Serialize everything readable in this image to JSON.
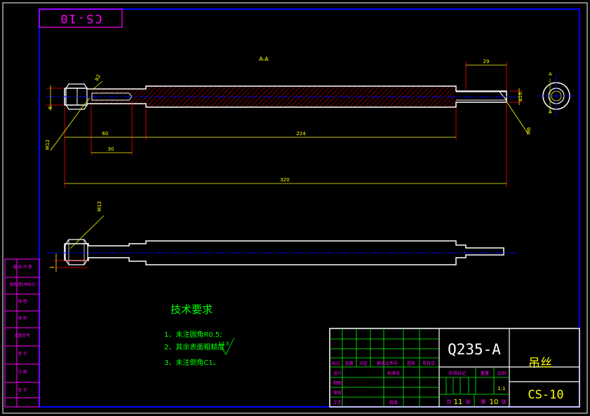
{
  "drawing_number_stamp": "CS-10",
  "section_label": "A-A",
  "section_marker": "A",
  "dimensions": {
    "d29": "29",
    "d16": "ø16",
    "d60": "60",
    "d30": "30",
    "d224": "224",
    "d320": "320",
    "r2": "R2",
    "m12_top": "M12",
    "m12_bottom": "M12",
    "m6": "M6",
    "d6": "6",
    "d1": "1"
  },
  "tech_requirements": {
    "title": "技术要求",
    "items": [
      "1、未注圆角R0.5;",
      "2、其余表面粗糙度",
      "3、未注倒角C1。"
    ],
    "roughness": "12.5"
  },
  "side_column": [
    "借 用 件 登",
    "描图(图)样标记",
    "描 图",
    "描 校",
    "底图总号",
    "签 字",
    "日 期",
    "签 字"
  ],
  "title_block": {
    "material": "Q235-A",
    "part_name": "吊丝",
    "drawing_code": "CS-10",
    "scale": "1:1",
    "revision_headers": [
      "标记",
      "处数",
      "分区",
      "更改文件号",
      "签名",
      "年月日"
    ],
    "roles": [
      "设计",
      "制图",
      "审核",
      "工艺"
    ],
    "std_label": "标准化",
    "approve_label": "批准",
    "stage_label": "阶段标记",
    "weight_label": "重量",
    "scale_label": "比例",
    "total_sheets": "11",
    "sheet_no": "10",
    "total_prefix": "共",
    "sheet_prefix": "第",
    "sheet_unit": "张"
  },
  "colors": {
    "frame": "#0000ff",
    "outline": "#ffffff",
    "dimension": "#ffff00",
    "hatch": "#ff0000",
    "grid": "#00ff00",
    "magenta": "#ff00ff",
    "centerline": "#0000ff"
  }
}
